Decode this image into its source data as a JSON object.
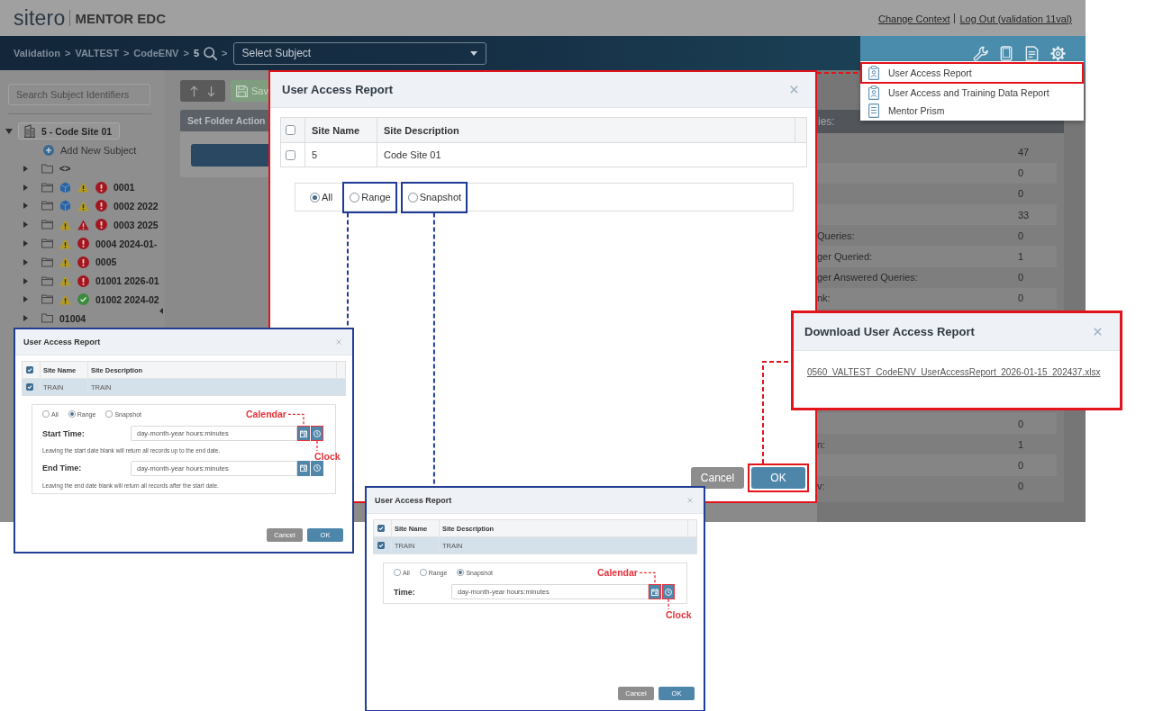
{
  "header": {
    "brand": "sitero",
    "product": "MENTOR EDC",
    "links": [
      "Change Context",
      "Log Out (validation 11val)"
    ]
  },
  "nav": {
    "breadcrumb": [
      {
        "kind": "link",
        "text": "Validation"
      },
      {
        "kind": "separator",
        "text": ">"
      },
      {
        "kind": "link",
        "text": "VALTEST"
      },
      {
        "kind": "separator",
        "text": ">"
      },
      {
        "kind": "link",
        "text": "CodeENV"
      },
      {
        "kind": "separator",
        "text": ">"
      },
      {
        "kind": "current",
        "text": "5"
      },
      {
        "kind": "search"
      },
      {
        "kind": "separator",
        "text": ">"
      }
    ],
    "subject_select": {
      "placeholder": "Select Subject"
    }
  },
  "sidebar": {
    "search": {
      "placeholder": "Search Subject Identifiers"
    },
    "tree": [
      {
        "label": "5 - Code Site 01",
        "expanded": true,
        "action": "Add New Subject",
        "children": [
          {
            "label": "<>",
            "expanded": false
          },
          {
            "label": "0001",
            "expanded": false,
            "status_icons": [
              {
                "kind": "cube"
              },
              {
                "kind": "warning"
              },
              {
                "kind": "error"
              }
            ]
          },
          {
            "label": "0002 2022",
            "expanded": false,
            "status_icons": [
              {
                "kind": "cube"
              },
              {
                "kind": "warning"
              },
              {
                "kind": "error"
              }
            ]
          },
          {
            "label": "0003 2025",
            "expanded": false,
            "status_icons": [
              {
                "kind": "warning"
              },
              {
                "kind": "alert"
              },
              {
                "kind": "error"
              }
            ]
          },
          {
            "label": "0004 2024-01-",
            "expanded": false,
            "status_icons": [
              {
                "kind": "warning"
              },
              {
                "kind": "error"
              }
            ]
          },
          {
            "label": "0005",
            "expanded": false,
            "status_icons": [
              {
                "kind": "warning"
              },
              {
                "kind": "error"
              }
            ]
          },
          {
            "label": "01001 2026-01",
            "expanded": false,
            "status_icons": [
              {
                "kind": "warning"
              },
              {
                "kind": "error"
              }
            ]
          },
          {
            "label": "01002 2024-02",
            "expanded": false,
            "status_icons": [
              {
                "kind": "warning"
              },
              {
                "kind": "ok"
              }
            ]
          },
          {
            "label": "01004",
            "expanded": false
          }
        ]
      }
    ]
  },
  "toolbar": {
    "save_label": "Sav"
  },
  "folder_panel": {
    "title": "Set Folder Action"
  },
  "stats_panel": {
    "title": "ies:",
    "row_groups": [
      [
        {
          "value": "47"
        },
        {
          "value": "0"
        },
        {
          "value": "0"
        },
        {
          "value": "33"
        },
        {
          "label": "Queries:",
          "value": "0"
        },
        {
          "label": "ger Queried:",
          "value": "1"
        },
        {
          "label": "ger Answered Queries:",
          "value": "0"
        },
        {
          "label": "nk:",
          "value": "0"
        }
      ],
      [
        {
          "value": "0"
        },
        {
          "label": "n:",
          "value": "1"
        },
        {
          "value": "0"
        },
        {
          "label": "v:",
          "value": "0"
        }
      ]
    ]
  },
  "menu": {
    "items": [
      {
        "kind": "report",
        "label": "User Access Report",
        "highlighted": true
      },
      {
        "kind": "report",
        "label": "User Access and Training Data Report",
        "highlighted": false
      },
      {
        "kind": "document",
        "label": "Mentor Prism",
        "highlighted": false
      }
    ]
  },
  "report_dialog": {
    "title": "User Access Report",
    "highlighted": true,
    "table": {
      "columns": [
        "Site Name",
        "Site Description"
      ],
      "header_checked": false,
      "rows": [
        {
          "checked": false,
          "selected": false,
          "cells": [
            "5",
            "Code Site 01"
          ]
        }
      ]
    },
    "modes": [
      {
        "label": "All",
        "selected": true,
        "highlighted": false
      },
      {
        "label": "Range",
        "selected": false,
        "highlighted": true
      },
      {
        "label": "Snapshot",
        "selected": false,
        "highlighted": true
      }
    ],
    "buttons": [
      {
        "kind": "secondary",
        "label": "Cancel",
        "highlighted": false
      },
      {
        "kind": "primary",
        "label": "OK",
        "highlighted": true
      }
    ]
  },
  "download_dialog": {
    "title": "Download User Access Report",
    "highlighted": true,
    "file_link": "0560_VALTEST_CodeENV_UserAccessReport_2026-01-15_202437.xlsx"
  },
  "insets": [
    {
      "title": "User Access Report",
      "table": {
        "columns": [
          "Site Name",
          "Site Description"
        ],
        "header_checked": true,
        "rows": [
          {
            "checked": true,
            "selected": true,
            "cells": [
              "TRAIN",
              "TRAIN"
            ]
          }
        ]
      },
      "modes": [
        {
          "label": "All",
          "selected": false
        },
        {
          "label": "Range",
          "selected": true
        },
        {
          "label": "Snapshot",
          "selected": false
        }
      ],
      "fields": [
        {
          "label": "Start Time:",
          "placeholder": "day-month-year hours:minutes",
          "hint": "Leaving the start date blank will return all records up to the end date.",
          "callouts": {
            "calendar": "Calendar",
            "clock": "Clock"
          }
        },
        {
          "label": "End Time:",
          "placeholder": "day-month-year hours:minutes",
          "hint": "Leaving the end date blank will return all records after the start date."
        }
      ],
      "buttons": [
        {
          "kind": "secondary",
          "label": "Cancel"
        },
        {
          "kind": "primary",
          "label": "OK"
        }
      ]
    },
    {
      "title": "User Access Report",
      "table": {
        "columns": [
          "Site Name",
          "Site Description"
        ],
        "header_checked": true,
        "rows": [
          {
            "checked": true,
            "selected": true,
            "cells": [
              "TRAIN",
              "TRAIN"
            ]
          }
        ]
      },
      "modes": [
        {
          "label": "All",
          "selected": false
        },
        {
          "label": "Range",
          "selected": false
        },
        {
          "label": "Snapshot",
          "selected": true
        }
      ],
      "fields": [
        {
          "label": "Time:",
          "placeholder": "day-month-year hours:minutes",
          "callouts": {
            "calendar": "Calendar",
            "clock": "Clock"
          }
        }
      ],
      "buttons": [
        {
          "kind": "secondary",
          "label": "Cancel"
        },
        {
          "kind": "primary",
          "label": "OK"
        }
      ]
    }
  ]
}
